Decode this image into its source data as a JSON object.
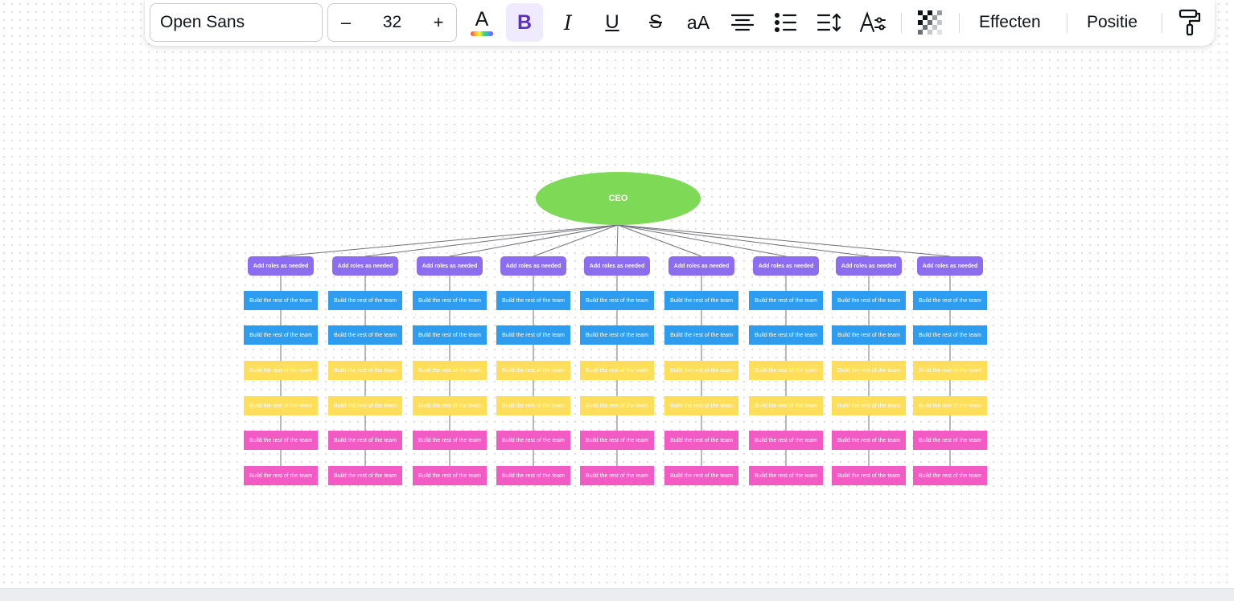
{
  "toolbar": {
    "font_family": "Open Sans",
    "font_size": "32",
    "decrease_label": "–",
    "increase_label": "+",
    "text_color_glyph": "A",
    "bold_glyph": "B",
    "italic_glyph": "I",
    "underline_glyph": "U",
    "strikethrough_glyph": "S",
    "case_glyph": "aA",
    "effects_label": "Effecten",
    "position_label": "Positie",
    "bold_active": true,
    "icons": [
      "text-color-icon",
      "bold-icon",
      "italic-icon",
      "underline-icon",
      "strikethrough-icon",
      "letter-case-icon",
      "align-center-icon",
      "bullet-list-icon",
      "line-spacing-icon",
      "text-options-icon",
      "transparency-icon",
      "paint-roller-icon"
    ]
  },
  "diagram": {
    "root_label": "CEO",
    "root_color": "#7ed957",
    "role_label": "Add roles as needed",
    "role_color": "#8c6cf0",
    "team_label": "Build the rest of the team",
    "column_count": 9,
    "row_colors": [
      "#2e9cef",
      "#2e9cef",
      "#ffde59",
      "#ffde59",
      "#f35bc4",
      "#f35bc4"
    ],
    "row_color_names": [
      "blue",
      "blue",
      "yellow",
      "yellow",
      "pink",
      "pink"
    ]
  }
}
